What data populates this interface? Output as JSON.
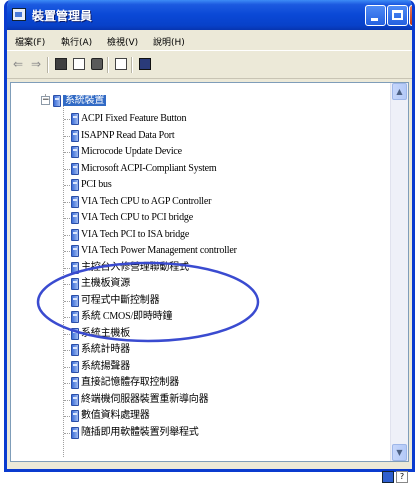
{
  "window": {
    "title": "裝置管理員"
  },
  "menu": [
    {
      "label": "檔案(F)"
    },
    {
      "label": "執行(A)"
    },
    {
      "label": "檢視(V)"
    },
    {
      "label": "說明(H)"
    }
  ],
  "toolbar": {
    "back_icon": "back-arrow-icon",
    "forward_icon": "forward-arrow-icon",
    "back_glyph": "⇐",
    "forward_glyph": "⇒"
  },
  "tree": {
    "root_label": "系統裝置",
    "expander_glyph": "−",
    "items": [
      {
        "label": "ACPI Fixed Feature Button"
      },
      {
        "label": "ISAPNP Read Data Port"
      },
      {
        "label": "Microcode Update Device"
      },
      {
        "label": "Microsoft ACPI-Compliant System"
      },
      {
        "label": "PCI bus"
      },
      {
        "label": "VIA Tech CPU to AGP Controller"
      },
      {
        "label": "VIA Tech CPU to PCI bridge"
      },
      {
        "label": "VIA Tech PCI to ISA bridge"
      },
      {
        "label": "VIA Tech Power Management controller"
      },
      {
        "label": "主控台入修營理聯動程式"
      },
      {
        "label": "主機板資源"
      },
      {
        "label": "可程式中斷控制器"
      },
      {
        "label": "系統 CMOS/即時時鐘"
      },
      {
        "label": "系統主機板"
      },
      {
        "label": "系統計時器"
      },
      {
        "label": "系統揚聲器"
      },
      {
        "label": "直接記憶體存取控制器"
      },
      {
        "label": "終端機伺服器裝置重新導向器"
      },
      {
        "label": "數值資料處理器"
      },
      {
        "label": "隨插即用軟體裝置列舉程式"
      }
    ]
  },
  "scrollbar": {
    "up_glyph": "▲",
    "down_glyph": "▼"
  },
  "statusbar": {
    "help_glyph": "?"
  },
  "colors": {
    "highlight_ellipse": "#3a4bd0",
    "selection": "#316ac5",
    "titlebar": "#0a48d6"
  }
}
